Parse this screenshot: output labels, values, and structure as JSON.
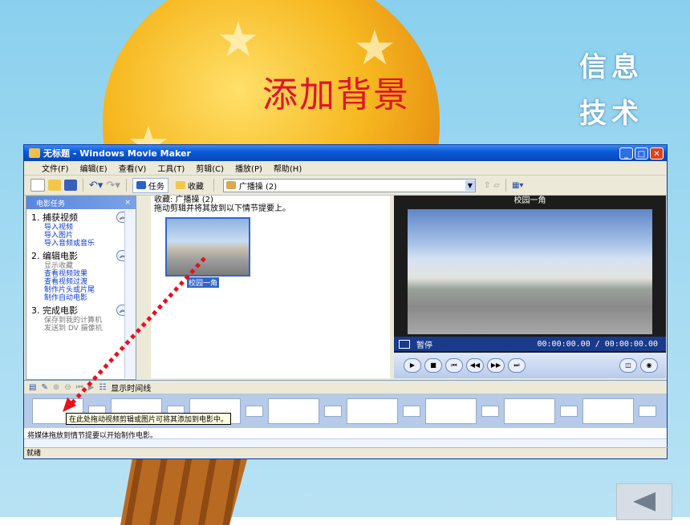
{
  "slide": {
    "title": "添加背景",
    "brand_line1": "信息",
    "brand_line2": "技术",
    "back_icon": "triangle-left-icon"
  },
  "window": {
    "title": "无标题 - Windows Movie Maker",
    "menu": [
      "文件(F)",
      "编辑(E)",
      "查看(V)",
      "工具(T)",
      "剪辑(C)",
      "播放(P)",
      "帮助(H)"
    ],
    "toolbar": {
      "tasks_label": "任务",
      "collections_label": "收藏",
      "collection_select": "广播操 (2)"
    },
    "taskpane": {
      "header": "电影任务",
      "sections": [
        {
          "title": "1. 捕获视频",
          "links": [
            "导入视频",
            "导入图片",
            "导入音频或音乐"
          ],
          "enabled": true
        },
        {
          "title": "2. 编辑电影",
          "links": [
            "显示收藏",
            "查看视频效果",
            "查看视频过渡",
            "制作片头或片尾",
            "制作自动电影"
          ],
          "enabled": true
        },
        {
          "title": "3. 完成电影",
          "links": [
            "保存到我的计算机",
            "发送到 DV 摄像机"
          ],
          "enabled": false
        }
      ]
    },
    "collection": {
      "title": "收藏: 广播操 (2)",
      "instruction": "拖动剪辑并将其放到以下情节提要上。",
      "clip_label": "校园一角"
    },
    "preview": {
      "title": "校园一角",
      "state": "暂停",
      "time": "00:00:00.00 / 00:00:00.00"
    },
    "storyboard": {
      "show_timeline_label": "显示时间线",
      "hint": "在此处拖动视频剪辑或图片可将其添加到电影中。",
      "message": "将媒体拖放到情节提要以开始制作电影。"
    },
    "status": "就绪"
  }
}
